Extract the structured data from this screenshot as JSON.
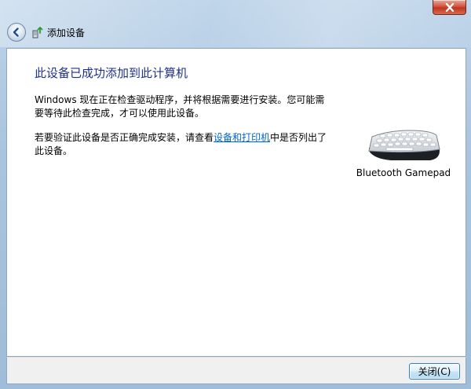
{
  "window": {
    "nav_title": "添加设备",
    "close_icon": "close-icon",
    "back_icon": "back-arrow-icon",
    "title_icon": "add-device-icon"
  },
  "content": {
    "heading": "此设备已成功添加到此计算机",
    "para1": "Windows 现在正在检查驱动程序，并将根据需要进行安装。您可能需要等待此检查完成，才可以使用此设备。",
    "para2_prefix": "若要验证此设备是否正确完成安装，请查看",
    "para2_link": "设备和打印机",
    "para2_suffix": "中是否列出了此设备。",
    "device_name": "Bluetooth Gamepad",
    "device_icon": "keyboard-icon"
  },
  "footer": {
    "close_button_label": "关闭(C)"
  },
  "colors": {
    "heading": "#1e3287",
    "link": "#0066cc"
  }
}
